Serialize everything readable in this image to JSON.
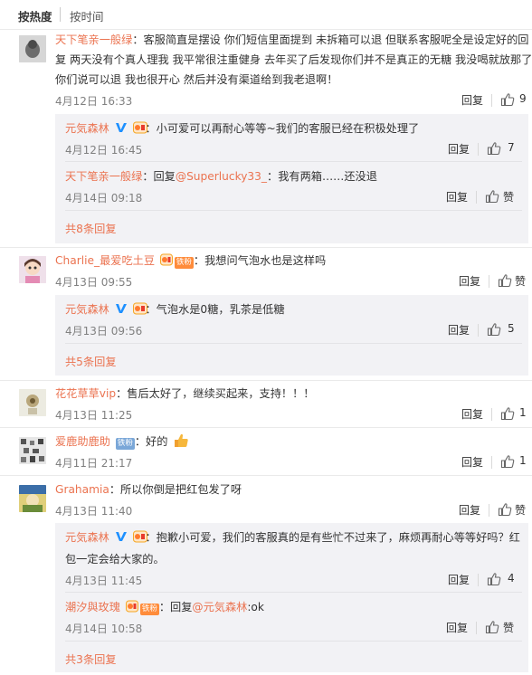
{
  "sort": {
    "hot": "按热度",
    "time": "按时间"
  },
  "comments": [
    {
      "user": "天下笔亲一般绿",
      "text1": "：客服简直是摆设 你们短信里面提到 未拆箱可以退 但联系客服呢全是设定好的回",
      "text2": "复 两天没有个真人理我 我平常很注重健身 去年买了后发现你们并不是真正的无糖 我没喝就放那了",
      "text3": "你们说可以退 我也很开心 然后并没有渠道给到我老退啊！",
      "date": "4月12日 16:33",
      "reply": "回复",
      "likes": "9",
      "replies": [
        {
          "user": "元気森林",
          "text": "：小可爱可以再耐心等等~我们的客服已经在积极处理了",
          "date": "4月12日 16:45",
          "reply": "回复",
          "likes": "7"
        },
        {
          "user": "天下笔亲一般绿",
          "text_pre": "：回复",
          "mention": "@Superlucky33_",
          "text_post": "：我有两箱……还没退",
          "date": "4月14日 09:18",
          "reply": "回复",
          "likes": "赞"
        }
      ],
      "more": "共8条回复"
    },
    {
      "user": "Charlie_最爱吃土豆",
      "fan_badge": "铁粉",
      "text": "：我想问气泡水也是这样吗",
      "date": "4月13日 09:55",
      "reply": "回复",
      "likes": "赞",
      "replies": [
        {
          "user": "元気森林",
          "text": "：气泡水是0糖，乳茶是低糖",
          "date": "4月13日 09:56",
          "reply": "回复",
          "likes": "5"
        }
      ],
      "more": "共5条回复"
    },
    {
      "user": "花花草草vip",
      "text": "：售后太好了，继续买起来，支持！！！",
      "date": "4月13日 11:25",
      "reply": "回复",
      "likes": "1"
    },
    {
      "user": "爱鹿助鹿助",
      "fan_badge": "铁粉",
      "text": "：好的",
      "date": "4月11日 21:17",
      "reply": "回复",
      "likes": "1"
    },
    {
      "user": "Grahamia",
      "text": "：所以你倒是把红包发了呀",
      "date": "4月13日 11:40",
      "reply": "回复",
      "likes": "赞",
      "replies": [
        {
          "user": "元気森林",
          "text1": "：抱歉小可爱，我们的客服真的是有些忙不过来了，麻烦再耐心等等好吗？红",
          "text2": "包一定会给大家的。",
          "date": "4月13日 11:45",
          "reply": "回复",
          "likes": "4"
        },
        {
          "user": "潮汐與玫瑰",
          "fan_badge": "铁粉",
          "text_pre": "：回复",
          "mention": "@元気森林",
          "text_post": ":ok",
          "date": "4月14日 10:58",
          "reply": "回复",
          "likes": "赞"
        }
      ],
      "more": "共3条回复"
    }
  ],
  "colors": {
    "link": "#eb7350",
    "date": "#808080",
    "sub_bg": "#f2f2f5",
    "verified": "#1e90ff",
    "fan_badge": "#ff8c3b",
    "fan_badge_blue": "#7aa7d8"
  }
}
